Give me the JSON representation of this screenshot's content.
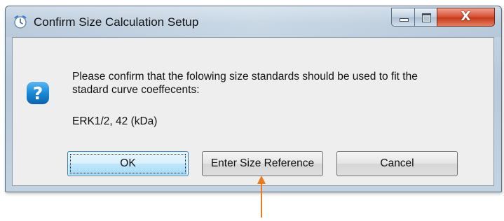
{
  "window": {
    "title": "Confirm Size Calculation Setup",
    "close_glyph": "X",
    "icons": {
      "app": "clock-icon",
      "minimize": "minimize-icon",
      "maximize": "maximize-icon",
      "close": "close-icon"
    }
  },
  "dialog": {
    "icon": "question-icon",
    "message_line1": "Please confirm that the folowing size standards should be used to fit the",
    "message_line2": "stadard curve coeffecents:",
    "standards_text": "ERK1/2, 42 (kDa)"
  },
  "buttons": {
    "ok_label": "OK",
    "enter_size_reference_label": "Enter Size Reference",
    "cancel_label": "Cancel"
  },
  "annotation": {
    "arrow_color": "#ec7a1c",
    "icon": "arrow-up-annotation"
  },
  "colors": {
    "question_icon": "#1a8ad8",
    "close_button": "#c8452a",
    "focused_button_border": "#3c7fb1"
  }
}
